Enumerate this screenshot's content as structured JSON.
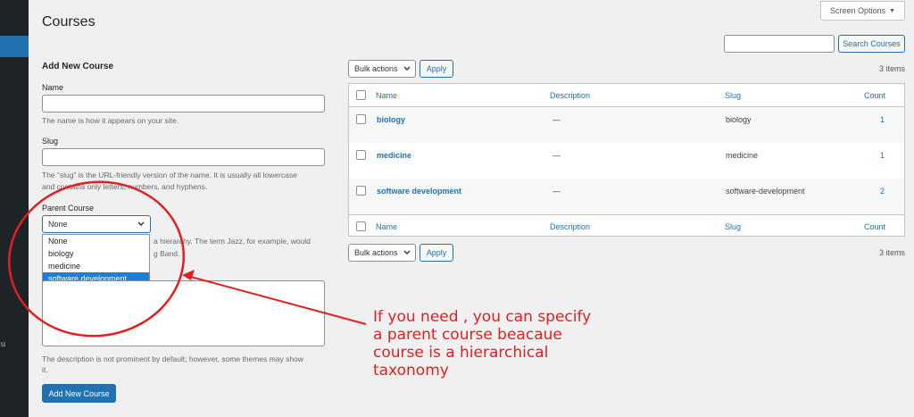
{
  "sidebar": {
    "truncated_text": "u"
  },
  "page": {
    "title": "Courses",
    "screen_options": "Screen Options",
    "screen_options_caret": "▼"
  },
  "search": {
    "button": "Search Courses",
    "value": ""
  },
  "form": {
    "title": "Add New Course",
    "name_label": "Name",
    "name_desc": "The name is how it appears on your site.",
    "slug_label": "Slug",
    "slug_desc_line1": "The “slug” is the URL-friendly version of the name. It is usually all lowercase",
    "slug_desc_line2": "and contains only letters, numbers, and hyphens.",
    "parent_label": "Parent Course",
    "parent_selected": "None",
    "parent_options": [
      "None",
      "biology",
      "medicine",
      "software development"
    ],
    "parent_desc_line1": "a hierarchy. The term Jazz, for example, would",
    "parent_desc_line2": "g Band.",
    "description_desc_line1": "The description is not prominent by default; however, some themes may show",
    "description_desc_line2": "it.",
    "submit": "Add New Course"
  },
  "bulk": {
    "label": "Bulk actions",
    "apply": "Apply",
    "items_count": "3 items"
  },
  "table": {
    "columns": {
      "name": "Name",
      "description": "Description",
      "slug": "Slug",
      "count": "Count"
    },
    "rows": [
      {
        "name": "biology",
        "description": "—",
        "slug": "biology",
        "count": "1"
      },
      {
        "name": "medicine",
        "description": "—",
        "slug": "medicine",
        "count": "1"
      },
      {
        "name": "software development",
        "description": "—",
        "slug": "software-development",
        "count": "2"
      }
    ]
  },
  "annotation": {
    "color": "#e0201e",
    "line1": "If you need , you can specify",
    "line2": "a parent course beacaue",
    "line3": "course is a hierarchical",
    "line4": "taxonomy"
  }
}
